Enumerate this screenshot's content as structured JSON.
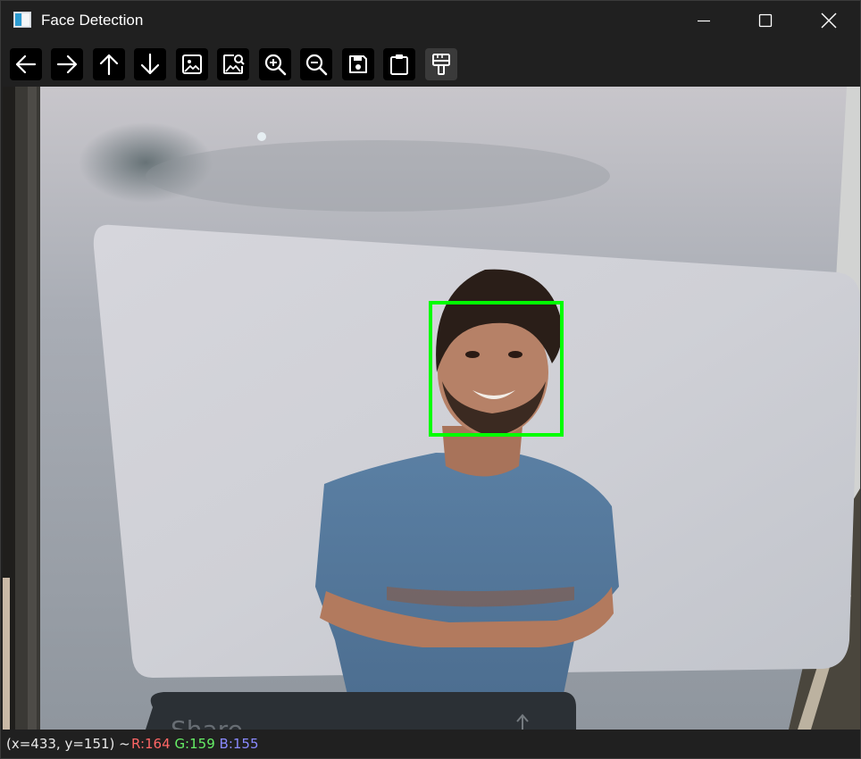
{
  "window": {
    "title": "Face Detection",
    "buttons": {
      "minimize": "minimize-icon",
      "maximize": "maximize-icon",
      "close": "close-icon"
    }
  },
  "toolbar": {
    "items": [
      {
        "name": "pan-left-button",
        "icon": "arrow-left-icon"
      },
      {
        "name": "pan-right-button",
        "icon": "arrow-right-icon"
      },
      {
        "name": "pan-up-button",
        "icon": "arrow-up-icon"
      },
      {
        "name": "pan-down-button",
        "icon": "arrow-down-icon"
      },
      {
        "name": "zoom-original-button",
        "icon": "image-icon"
      },
      {
        "name": "zoom-fit-button",
        "icon": "image-search-icon"
      },
      {
        "name": "zoom-in-button",
        "icon": "zoom-in-icon"
      },
      {
        "name": "zoom-out-button",
        "icon": "zoom-out-icon"
      },
      {
        "name": "save-button",
        "icon": "save-icon"
      },
      {
        "name": "copy-clipboard-button",
        "icon": "clipboard-icon"
      },
      {
        "name": "properties-button",
        "icon": "paint-brush-icon"
      }
    ]
  },
  "image": {
    "detections": [
      {
        "label": "face",
        "color": "#00ff00"
      }
    ],
    "partial_text": "Share"
  },
  "status": {
    "coords": "(x=433, y=151) ~",
    "r": "R:164",
    "g": "G:159",
    "b": "B:155"
  },
  "colors": {
    "r": "#ff6666",
    "g": "#66ee66",
    "b": "#8a8aff",
    "detection_box": "#00ff00"
  }
}
